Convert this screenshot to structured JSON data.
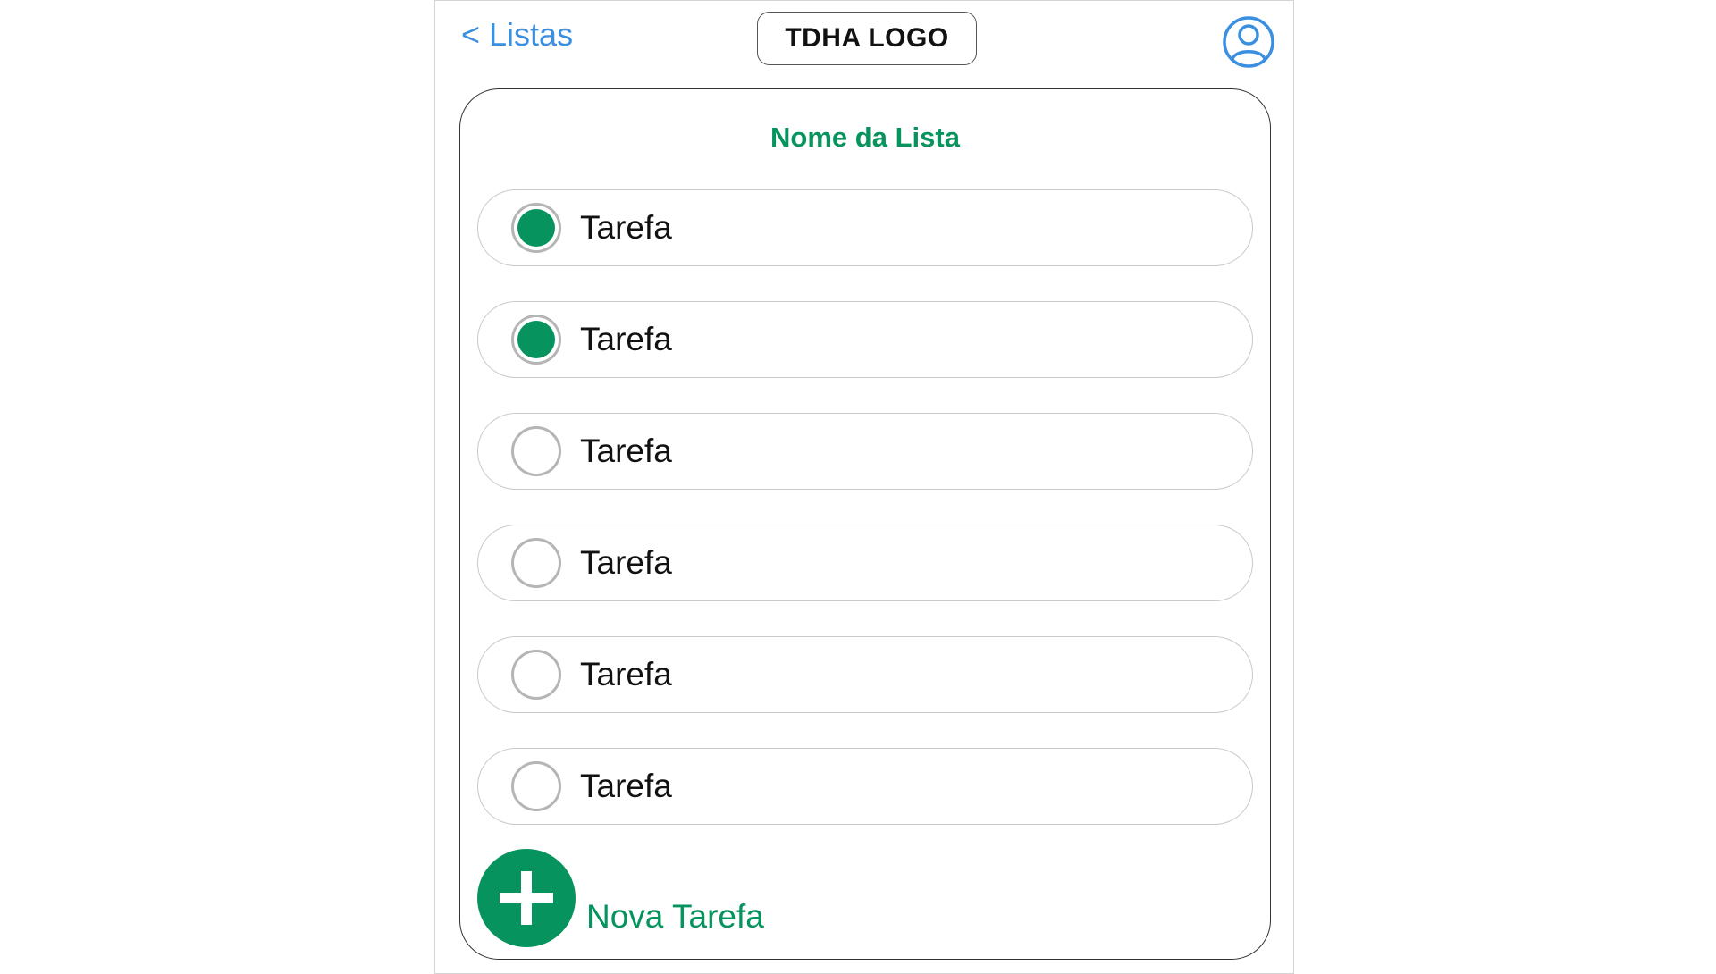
{
  "header": {
    "back_label": "< Listas",
    "logo_text": "TDHA LOGO",
    "profile_icon": "user-circle-icon"
  },
  "list": {
    "title": "Nome da Lista",
    "tasks": [
      {
        "label": "Tarefa",
        "done": true
      },
      {
        "label": "Tarefa",
        "done": true
      },
      {
        "label": "Tarefa",
        "done": false
      },
      {
        "label": "Tarefa",
        "done": false
      },
      {
        "label": "Tarefa",
        "done": false
      },
      {
        "label": "Tarefa",
        "done": false
      }
    ],
    "add_label": "Nova Tarefa",
    "add_icon": "plus-icon"
  },
  "colors": {
    "accent": "#06935d",
    "link": "#3a8fe0",
    "radio_border": "#b5b5b5"
  }
}
